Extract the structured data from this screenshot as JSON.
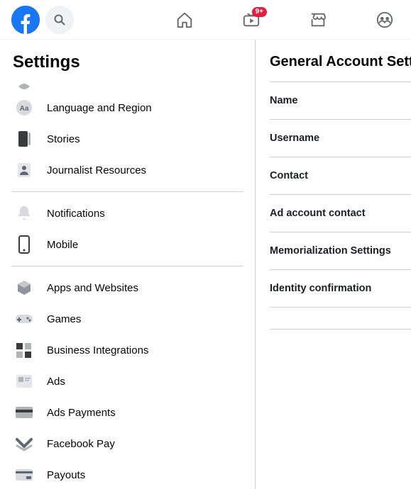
{
  "header": {
    "watch_badge": "9+"
  },
  "sidebar": {
    "title": "Settings",
    "group1": [
      {
        "label": "Language and Region"
      },
      {
        "label": "Stories"
      },
      {
        "label": "Journalist Resources"
      }
    ],
    "group2": [
      {
        "label": "Notifications"
      },
      {
        "label": "Mobile"
      }
    ],
    "group3": [
      {
        "label": "Apps and Websites"
      },
      {
        "label": "Games"
      },
      {
        "label": "Business Integrations"
      },
      {
        "label": "Ads"
      },
      {
        "label": "Ads Payments"
      },
      {
        "label": "Facebook Pay"
      },
      {
        "label": "Payouts"
      }
    ]
  },
  "main": {
    "title": "General Account Settings",
    "rows": [
      "Name",
      "Username",
      "Contact",
      "Ad account contact",
      "Memorialization Settings",
      "Identity confirmation"
    ]
  }
}
